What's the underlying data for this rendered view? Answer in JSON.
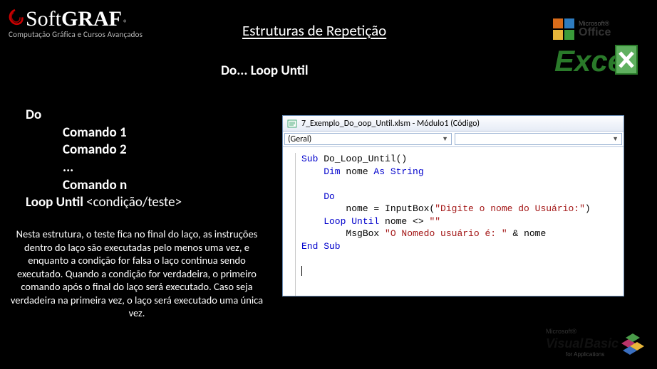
{
  "logo": {
    "soft": "Soft",
    "graf": "GRAF",
    "reg": "®",
    "tagline": "Computação Gráfica e Cursos Avançados"
  },
  "title": "Estruturas de Repetição",
  "subtitle": "Do... Loop Until",
  "syntax": {
    "do": "Do",
    "c1": "Comando 1",
    "c2": "Comando 2",
    "dots": "...",
    "cn": "Comando n",
    "loop": "Loop Until ",
    "cond": "<condição/teste>"
  },
  "explain": "Nesta estrutura, o teste fica no final do laço, as instruções dentro do laço são executadas pelo menos uma vez, e enquanto a condição for falsa o laço continua sendo executado. Quando a condição for verdadeira, o primeiro comando após o final do laço será executado. Caso seja verdadeira na primeira vez, o laço será executado uma única vez.",
  "codewindow": {
    "title": "7_Exemplo_Do_oop_Until.xlsm - Módulo1 (Código)",
    "dropdown_left": "(Geral)",
    "dropdown_right": "",
    "code": {
      "l1a": "Sub",
      "l1b": " Do_Loop_Until()",
      "l2a": "    Dim",
      "l2b": " nome ",
      "l2c": "As String",
      "l3": "",
      "l4a": "    Do",
      "l5a": "        nome = InputBox(",
      "l5b": "\"Digite o nome do Usuário:\"",
      "l5c": ")",
      "l6a": "    Loop Until",
      "l6b": " nome <> ",
      "l6c": "\"\"",
      "l7a": "        MsgBox ",
      "l7b": "\"O Nomedo usuário é: \"",
      "l7c": " & nome",
      "l8a": "End Sub"
    }
  },
  "brands": {
    "office": "Microsoft® Office",
    "excel": "Excel",
    "vb1": "Microsoft®",
    "vb2": "Visual Basic",
    "vb3": "for Applications"
  }
}
